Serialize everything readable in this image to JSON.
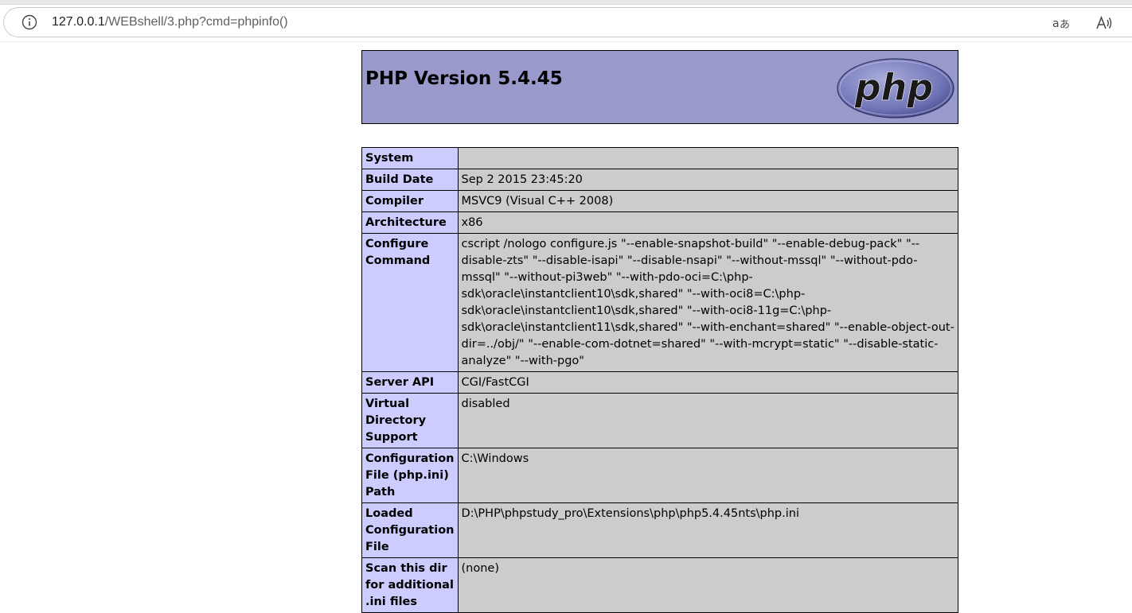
{
  "browser": {
    "url_host": "127.0.0.1",
    "url_path": "/WEBshell/3.php?cmd=phpinfo()",
    "icons": [
      "info-icon",
      "translate-icon",
      "read-aloud-icon"
    ]
  },
  "header": {
    "title": "PHP Version 5.4.45",
    "logo_text": "php"
  },
  "rows": [
    {
      "key": "System",
      "value": ""
    },
    {
      "key": "Build Date",
      "value": "Sep 2 2015 23:45:20"
    },
    {
      "key": "Compiler",
      "value": "MSVC9 (Visual C++ 2008)"
    },
    {
      "key": "Architecture",
      "value": "x86"
    },
    {
      "key": "Configure Command",
      "value": "cscript /nologo configure.js \"--enable-snapshot-build\" \"--enable-debug-pack\" \"--disable-zts\" \"--disable-isapi\" \"--disable-nsapi\" \"--without-mssql\" \"--without-pdo-mssql\" \"--without-pi3web\" \"--with-pdo-oci=C:\\php-sdk\\oracle\\instantclient10\\sdk,shared\" \"--with-oci8=C:\\php-sdk\\oracle\\instantclient10\\sdk,shared\" \"--with-oci8-11g=C:\\php-sdk\\oracle\\instantclient11\\sdk,shared\" \"--with-enchant=shared\" \"--enable-object-out-dir=../obj/\" \"--enable-com-dotnet=shared\" \"--with-mcrypt=static\" \"--disable-static-analyze\" \"--with-pgo\""
    },
    {
      "key": "Server API",
      "value": "CGI/FastCGI"
    },
    {
      "key": "Virtual Directory Support",
      "value": "disabled"
    },
    {
      "key": "Configuration File (php.ini) Path",
      "value": "C:\\Windows"
    },
    {
      "key": "Loaded Configuration File",
      "value": "D:\\PHP\\phpstudy_pro\\Extensions\\php\\php5.4.45nts\\php.ini"
    },
    {
      "key": "Scan this dir for additional .ini files",
      "value": "(none)"
    }
  ],
  "colors": {
    "header_bg": "#9999cc",
    "key_bg": "#ccccff",
    "value_bg": "#cccccc"
  }
}
